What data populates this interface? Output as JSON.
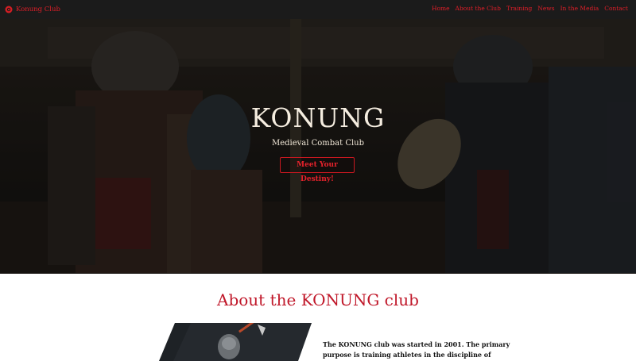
{
  "navbar": {
    "brand": "Konung Club",
    "links": [
      "Home",
      "About the Club",
      "Training",
      "News",
      "In the Media",
      "Contact"
    ]
  },
  "hero": {
    "title": "KONUNG",
    "subtitle": "Medieval Combat Club",
    "cta": "Meet Your Destiny!"
  },
  "about": {
    "title": "About the KONUNG club",
    "text_line1": "The KONUNG club was started in 2001. The primary",
    "text_line2": "purpose is training athletes in the discipline of"
  },
  "colors": {
    "accent": "#e01e28",
    "about_title": "#c0182a",
    "navbar_bg": "#1b1b1b"
  }
}
